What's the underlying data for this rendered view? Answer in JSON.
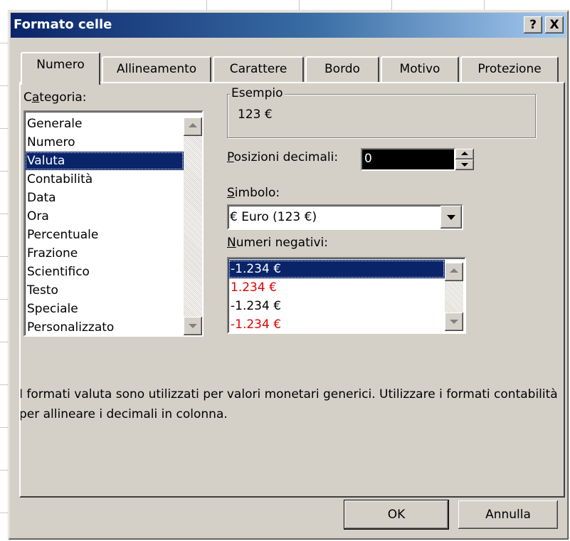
{
  "dialog": {
    "title": "Formato celle",
    "help_label": "?",
    "close_label": "X"
  },
  "tabs": [
    {
      "label": "Numero",
      "active": true
    },
    {
      "label": "Allineamento",
      "active": false
    },
    {
      "label": "Carattere",
      "active": false
    },
    {
      "label": "Bordo",
      "active": false
    },
    {
      "label": "Motivo",
      "active": false
    },
    {
      "label": "Protezione",
      "active": false
    }
  ],
  "category": {
    "label_prefix": "C",
    "label_accel": "a",
    "label_suffix": "tegoria:",
    "items": [
      "Generale",
      "Numero",
      "Valuta",
      "Contabilità",
      "Data",
      "Ora",
      "Percentuale",
      "Frazione",
      "Scientifico",
      "Testo",
      "Speciale",
      "Personalizzato"
    ],
    "selected": "Valuta"
  },
  "sample": {
    "legend": "Esempio",
    "value": "123 €"
  },
  "decimals": {
    "label_accel": "P",
    "label_rest": "osizioni decimali:",
    "value": "0"
  },
  "symbol": {
    "label_accel": "S",
    "label_rest": "imbolo:",
    "value": "€ Euro (123 €)"
  },
  "negative": {
    "label_accel": "N",
    "label_rest": "umeri negativi:",
    "items": [
      {
        "text": "-1.234 €",
        "style": "selected"
      },
      {
        "text": "1.234 €",
        "style": "red"
      },
      {
        "text": "-1.234 €",
        "style": "normal"
      },
      {
        "text": "-1.234 €",
        "style": "red"
      }
    ]
  },
  "description": "I formati valuta sono utilizzati per valori  monetari generici. Utilizzare i formati contabilità per allineare i decimali in colonna.",
  "buttons": {
    "ok": "OK",
    "cancel": "Annulla"
  },
  "colors": {
    "title_gradient_start": "#0a246a",
    "title_gradient_end": "#a6caf0",
    "selection": "#0a246a",
    "negative_red": "#e00000",
    "face": "#d4d0c8"
  }
}
